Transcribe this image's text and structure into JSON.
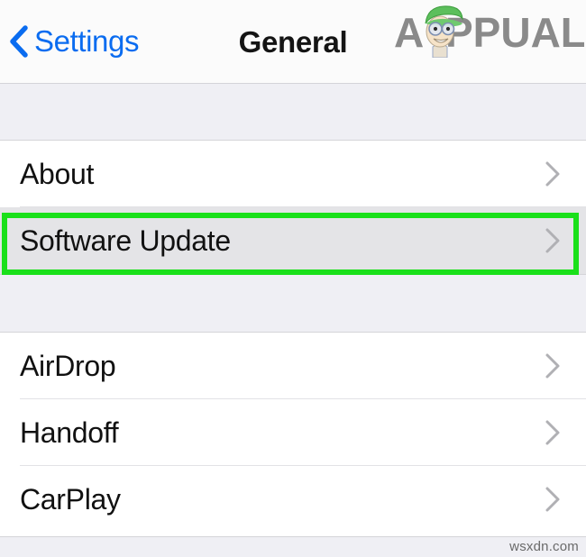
{
  "colors": {
    "ios_blue": "#0a6cf0",
    "highlight_green": "#1ae01a",
    "background_grey": "#efeff4",
    "row_white": "#ffffff",
    "row_pressed": "#e4e4e7",
    "chevron_grey": "#b0b0b4",
    "title_black": "#141414"
  },
  "navbar": {
    "back_label": "Settings",
    "back_icon": "chevron-left-icon",
    "title": "General"
  },
  "logo": {
    "text_before": "A",
    "text_after": "PUALS",
    "full_text": "APPUALS",
    "cap_color": "#5cbf5c",
    "letter_color": "#8a8a8a",
    "face_color": "#f6e3c8"
  },
  "sections": [
    {
      "name": "section-1",
      "rows": [
        {
          "label": "About",
          "icon": "chevron-right-icon",
          "pressed": false,
          "separator": true
        },
        {
          "label": "Software Update",
          "icon": "chevron-right-icon",
          "pressed": true,
          "separator": false
        }
      ]
    },
    {
      "name": "section-2",
      "rows": [
        {
          "label": "AirDrop",
          "icon": "chevron-right-icon",
          "pressed": false,
          "separator": true
        },
        {
          "label": "Handoff",
          "icon": "chevron-right-icon",
          "pressed": false,
          "separator": true
        },
        {
          "label": "CarPlay",
          "icon": "chevron-right-icon",
          "pressed": false,
          "separator": false
        }
      ]
    }
  ],
  "highlight": {
    "target_row": "Software Update",
    "color": "#1ae01a"
  },
  "footer": {
    "watermark": "wsxdn.com"
  }
}
